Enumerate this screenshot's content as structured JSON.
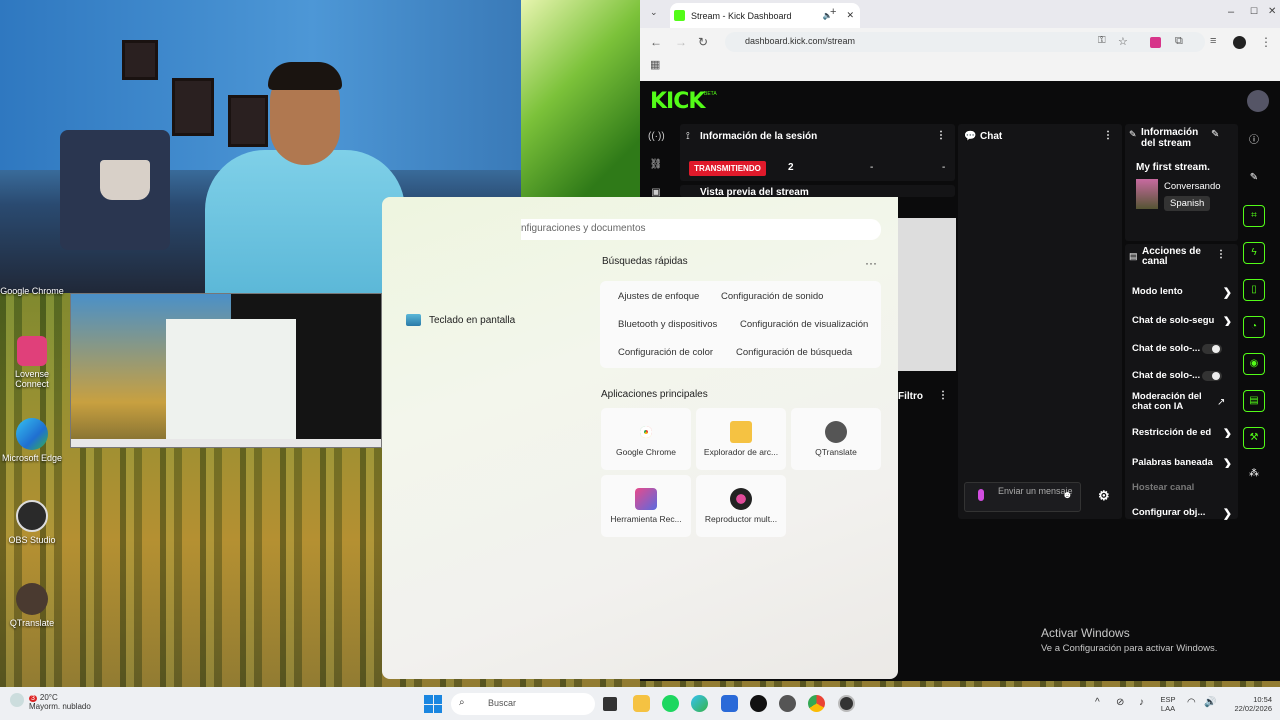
{
  "desktop": {
    "icons": [
      {
        "label": "Google Chrome",
        "icon": "chrome-icon"
      },
      {
        "label": "Lovense Connect",
        "icon": "lovense-icon"
      },
      {
        "label": "Microsoft Edge",
        "icon": "edge-icon"
      },
      {
        "label": "OBS Studio",
        "icon": "obs-icon"
      },
      {
        "label": "QTranslate",
        "icon": "qtranslate-icon"
      }
    ]
  },
  "start_panel": {
    "search_placeholder": "nfiguraciones y documentos",
    "left_item": "Teclado en pantalla",
    "quick_title": "Búsquedas rápidas",
    "more_label": "···",
    "chips": [
      "Ajustes de enfoque",
      "Configuración de sonido",
      "Bluetooth y dispositivos",
      "Configuración de visualización",
      "Configuración de color",
      "Configuración de búsqueda"
    ],
    "apps_title": "Aplicaciones principales",
    "apps": [
      {
        "label": "Google Chrome",
        "icon": "chrome-icon"
      },
      {
        "label": "Explorador de arc...",
        "icon": "folder-icon"
      },
      {
        "label": "QTranslate",
        "icon": "qtranslate-icon"
      },
      {
        "label": "Herramienta Rec...",
        "icon": "snipping-tool-icon"
      },
      {
        "label": "Reproductor mult...",
        "icon": "media-player-icon"
      }
    ]
  },
  "browser": {
    "tab_title": "Stream - Kick Dashboard",
    "new_tab": "+",
    "url": "dashboard.kick.com/stream",
    "window_controls": [
      "–",
      "☐",
      "✕"
    ]
  },
  "kick": {
    "logo": "KICK",
    "beta": "BETA",
    "session_panel": {
      "title": "Información de la sesión",
      "live_label": "TRANSMITIENDO",
      "viewers": "2",
      "dash1": "-",
      "dash2": "-",
      "preview_title": "Vista previa del stream"
    },
    "chat_panel": {
      "title": "Chat",
      "input_placeholder": "Enviar un mensaje",
      "filter_label": "Filtro"
    },
    "stream_info": {
      "title": "Información del stream",
      "stream_title": "My first stream.",
      "category": "Conversando",
      "language": "Spanish"
    },
    "channel_actions": {
      "title": "Acciones de canal",
      "items": [
        {
          "label": "Modo lento",
          "control": "chevron"
        },
        {
          "label": "Chat de solo-segu",
          "control": "chevron"
        },
        {
          "label": "Chat de solo-...",
          "control": "toggle"
        },
        {
          "label": "Chat de solo-...",
          "control": "toggle"
        },
        {
          "label": "Moderación del chat con IA",
          "control": "external"
        },
        {
          "label": "Restricción de ed",
          "control": "chevron"
        },
        {
          "label": "Palabras baneada",
          "control": "chevron"
        },
        {
          "label": "Hostear canal",
          "control": "none"
        },
        {
          "label": "Configurar obj...",
          "control": "chevron"
        }
      ]
    }
  },
  "watermark": {
    "line1": "Activar Windows",
    "line2": "Ve a Configuración para activar Windows."
  },
  "taskbar": {
    "weather_temp": "20°C",
    "weather_desc": "Mayorm. nublado",
    "weather_badge": "3",
    "search_label": "Buscar",
    "lang1": "ESP",
    "lang2": "LAA",
    "time": "10:54",
    "date": "22/02/2026"
  }
}
